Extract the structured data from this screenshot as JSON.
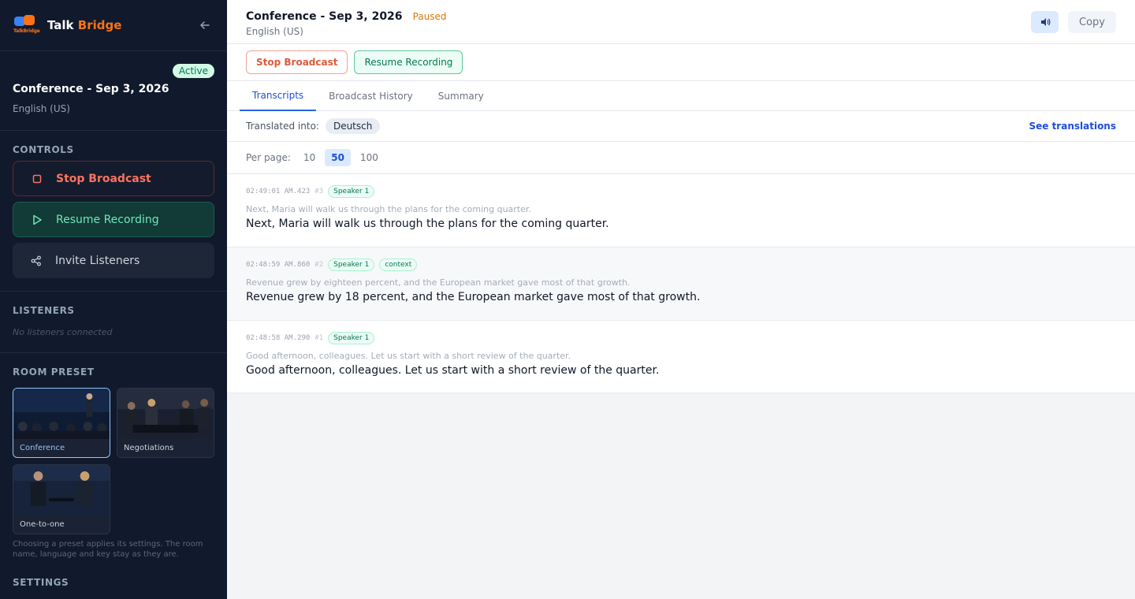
{
  "brand": {
    "name_part1": "Talk",
    "name_part2": "Bridge",
    "logo_text": "TalkBridge",
    "collapse_icon": "arrow-left-icon"
  },
  "session": {
    "badge": "Active",
    "title": "Conference - Sep 3, 2026",
    "language": "English (US)"
  },
  "controls": {
    "label": "CONTROLS",
    "stop": "Stop Broadcast",
    "resume": "Resume Recording",
    "invite": "Invite Listeners"
  },
  "listeners": {
    "label": "LISTENERS",
    "empty": "No listeners connected"
  },
  "preset": {
    "label": "ROOM PRESET",
    "items": [
      {
        "label": "Conference",
        "selected": true
      },
      {
        "label": "Negotiations",
        "selected": false
      },
      {
        "label": "One-to-one",
        "selected": false
      }
    ],
    "note": "Choosing a preset applies its settings. The room name, language and key stay as they are."
  },
  "settings": {
    "label": "SETTINGS"
  },
  "header": {
    "title": "Conference - Sep 3, 2026",
    "status": "Paused",
    "language": "English (US)",
    "speaker_icon": "speaker-icon",
    "copy": "Copy"
  },
  "actions": {
    "stop": "Stop Broadcast",
    "resume": "Resume Recording"
  },
  "tabs": [
    {
      "label": "Transcripts",
      "active": true
    },
    {
      "label": "Broadcast History",
      "active": false
    },
    {
      "label": "Summary",
      "active": false
    }
  ],
  "translation": {
    "label": "Translated into:",
    "language": "Deutsch",
    "link": "See translations"
  },
  "pagination": {
    "label": "Per page:",
    "options": [
      "10",
      "50",
      "100"
    ],
    "selected": "50"
  },
  "entries": [
    {
      "time": "02:49:01 AM.423",
      "num": "#3",
      "speaker": "Speaker 1",
      "tag": "",
      "source": "Next, Maria will walk us through the plans for the coming quarter.",
      "text": "Next, Maria will walk us through the plans for the coming quarter."
    },
    {
      "time": "02:48:59 AM.860",
      "num": "#2",
      "speaker": "Speaker 1",
      "tag": "context",
      "source": "Revenue grew by eighteen percent, and the European market gave most of that growth.",
      "text": "Revenue grew by 18 percent, and the European market gave most of that growth."
    },
    {
      "time": "02:48:58 AM.290",
      "num": "#1",
      "speaker": "Speaker 1",
      "tag": "",
      "source": "Good afternoon, colleagues. Let us start with a short review of the quarter.",
      "text": "Good afternoon, colleagues. Let us start with a short review of the quarter."
    }
  ]
}
